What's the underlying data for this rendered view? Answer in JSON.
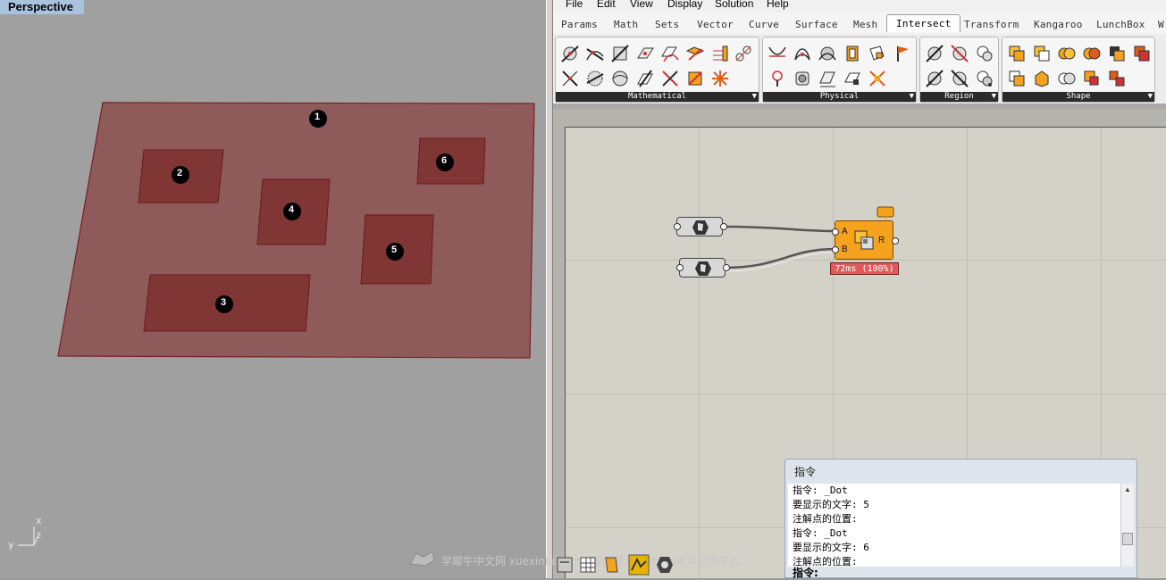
{
  "viewport": {
    "title": "Perspective",
    "dots": [
      "1",
      "2",
      "3",
      "4",
      "5",
      "6"
    ],
    "axes": {
      "x": "x",
      "y": "y",
      "z": "z"
    }
  },
  "menu": [
    "File",
    "Edit",
    "View",
    "Display",
    "Solution",
    "Help"
  ],
  "tabs": [
    "Params",
    "Math",
    "Sets",
    "Vector",
    "Curve",
    "Surface",
    "Mesh",
    "Intersect",
    "Transform",
    "Kangaroo",
    "LunchBox",
    "W"
  ],
  "active_tab": "Intersect",
  "panels": [
    "Mathematical",
    "Physical",
    "Region",
    "Shape"
  ],
  "component": {
    "inputs": [
      "A",
      "B"
    ],
    "output": "R",
    "timer": "72ms (100%)"
  },
  "command_window": {
    "title": "指令",
    "lines": [
      "指令: _Dot",
      "要显示的文字: 5",
      "注解点的位置:",
      "指令: _Dot",
      "要显示的文字: 6",
      "注解点的位置:"
    ],
    "prompt": "指令:"
  },
  "watermark": "学犀牛中文网 xuexiniu.com - 国内最大的Rhino技术交流平台",
  "colors": {
    "surface_fill": "#8f5555",
    "region_fill": "#7f3b3b",
    "component_orange": "#f5a31e",
    "timer_red": "#e05a5a",
    "viewport_title_bg": "#a9c2dd"
  }
}
